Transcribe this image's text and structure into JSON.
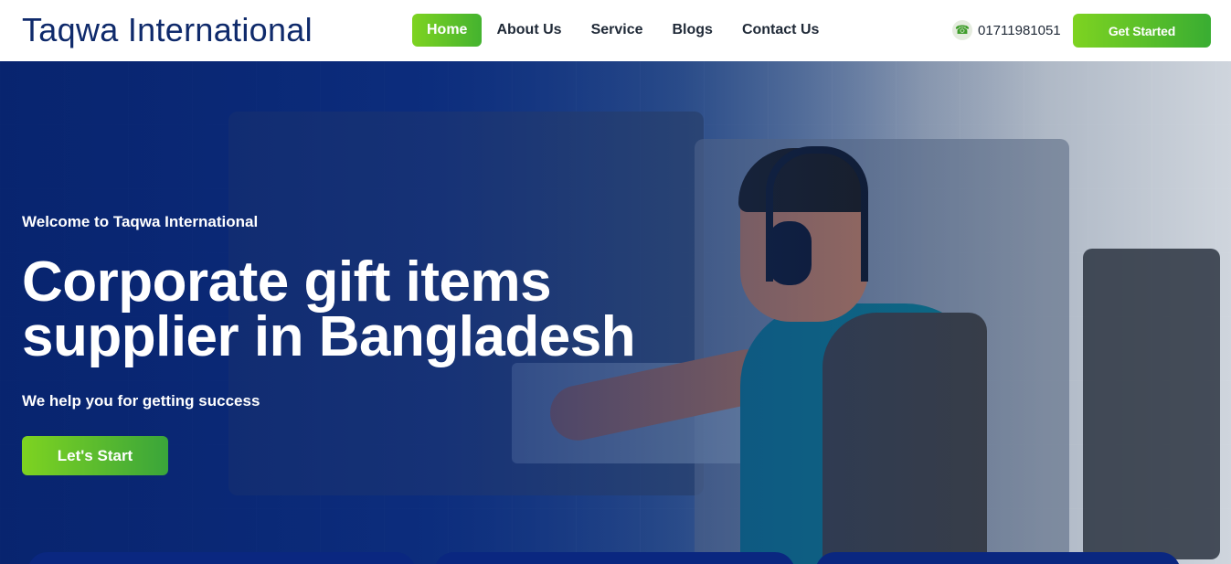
{
  "brand": {
    "name": "Taqwa International"
  },
  "nav": {
    "items": [
      {
        "label": "Home",
        "active": true
      },
      {
        "label": "About Us",
        "active": false
      },
      {
        "label": "Service",
        "active": false
      },
      {
        "label": "Blogs",
        "active": false
      },
      {
        "label": "Contact Us",
        "active": false
      }
    ]
  },
  "contact": {
    "phone": "01711981051",
    "icon": "phone-icon"
  },
  "header_cta": {
    "label": "Get Started"
  },
  "hero": {
    "welcome": "Welcome to Taqwa International",
    "headline": "Corporate gift items supplier in Bangladesh",
    "subtitle": "We help you for getting success",
    "cta_label": "Let's Start"
  },
  "colors": {
    "brand_blue": "#0f2a6b",
    "accent_green": "#7ed321",
    "hero_overlay": "#0a2b78"
  }
}
